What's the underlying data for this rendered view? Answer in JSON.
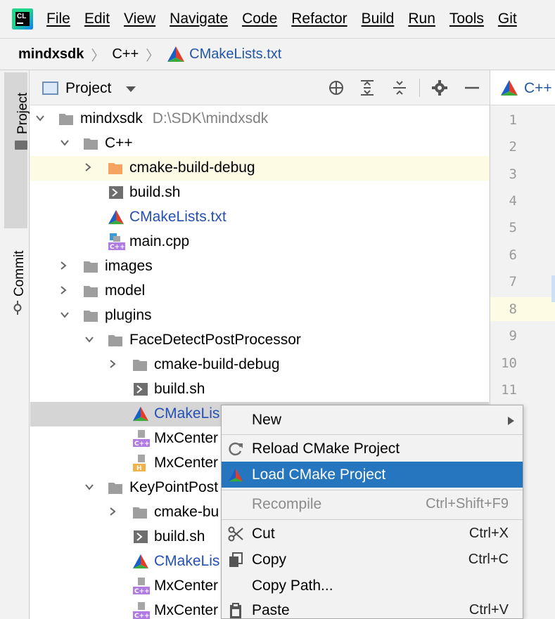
{
  "menubar": {
    "app_icon": "clion-logo-icon",
    "app_icon_text": "CL",
    "items": [
      "File",
      "Edit",
      "View",
      "Navigate",
      "Code",
      "Refactor",
      "Build",
      "Run",
      "Tools",
      "Git"
    ]
  },
  "breadcrumb": {
    "root": "mindxsdk",
    "folder": "C++",
    "file": "CMakeLists.txt"
  },
  "left_strip": {
    "project_label": "Project",
    "commit_label": "Commit"
  },
  "project_panel": {
    "title": "Project",
    "icons": [
      "locate-icon",
      "expand-all-icon",
      "collapse-all-icon",
      "gear-icon",
      "minimize-icon"
    ]
  },
  "tree": {
    "rows": [
      {
        "label": "mindxsdk",
        "path": "D:\\SDK\\mindxsdk",
        "icon": "folder-icon",
        "expanded": true
      },
      {
        "label": "C++",
        "icon": "folder-icon",
        "expanded": true
      },
      {
        "label": "cmake-build-debug",
        "icon": "orange-folder-icon",
        "expanded": false
      },
      {
        "label": "build.sh",
        "icon": "shell-script-icon"
      },
      {
        "label": "CMakeLists.txt",
        "icon": "cmake-icon"
      },
      {
        "label": "main.cpp",
        "icon": "cpp-file-icon"
      },
      {
        "label": "images",
        "icon": "folder-icon",
        "expanded": false
      },
      {
        "label": "model",
        "icon": "folder-icon",
        "expanded": false
      },
      {
        "label": "plugins",
        "icon": "folder-icon",
        "expanded": true
      },
      {
        "label": "FaceDetectPostProcessor",
        "icon": "folder-icon",
        "expanded": true
      },
      {
        "label": "cmake-build-debug",
        "icon": "folder-icon",
        "expanded": false
      },
      {
        "label": "build.sh",
        "icon": "shell-script-icon"
      },
      {
        "label": "CMakeLis",
        "icon": "cmake-icon"
      },
      {
        "label": "MxCenter",
        "icon": "cpp-file-icon"
      },
      {
        "label": "MxCenter",
        "icon": "header-file-icon"
      },
      {
        "label": "KeyPointPost",
        "icon": "folder-icon",
        "expanded": true
      },
      {
        "label": "cmake-bu",
        "icon": "folder-icon",
        "expanded": false
      },
      {
        "label": "build.sh",
        "icon": "shell-script-icon"
      },
      {
        "label": "CMakeLis",
        "icon": "cmake-icon"
      },
      {
        "label": "MxCenter",
        "icon": "cpp-file-icon"
      },
      {
        "label": "MxCenter",
        "icon": "cpp-file-icon"
      }
    ]
  },
  "editor": {
    "tab_label": "C++",
    "line_numbers": [
      "1",
      "2",
      "3",
      "4",
      "5",
      "6",
      "7",
      "8",
      "9",
      "10",
      "11"
    ]
  },
  "context_menu": {
    "items": [
      {
        "label": "New",
        "has_submenu": true
      },
      {
        "label": "Reload CMake Project",
        "icon": "reload-icon"
      },
      {
        "label": "Load CMake Project",
        "icon": "cmake-icon",
        "active": true
      },
      {
        "label": "Recompile",
        "shortcut": "Ctrl+Shift+F9",
        "disabled": true
      },
      {
        "label": "Cut",
        "shortcut": "Ctrl+X",
        "icon": "scissors-icon"
      },
      {
        "label": "Copy",
        "shortcut": "Ctrl+C",
        "icon": "copy-icon"
      },
      {
        "label": "Copy Path...",
        "shortcut": ""
      },
      {
        "label": "Paste",
        "shortcut": "Ctrl+V",
        "icon": "paste-icon"
      }
    ]
  },
  "colors": {
    "selection_blue": "#2675bf",
    "link_blue": "#2357a6",
    "caret_row_yellow": "#fdfbe3",
    "folder_gray": "#9e9e9e",
    "excluded_folder_orange": "#f4a460"
  }
}
